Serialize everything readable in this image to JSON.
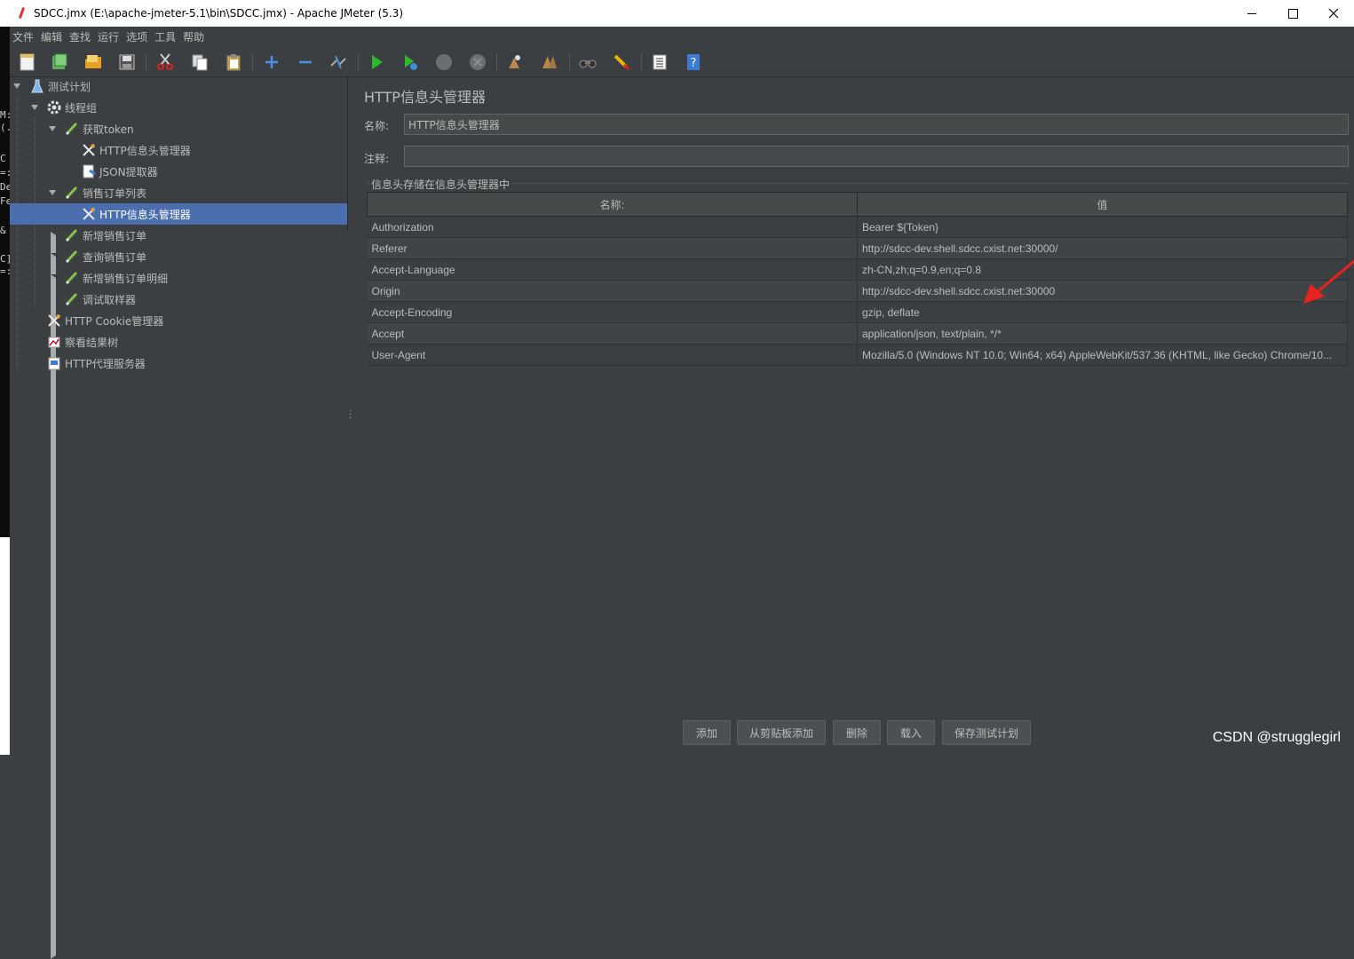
{
  "window": {
    "title": "SDCC.jmx (E:\\apache-jmeter-5.1\\bin\\SDCC.jmx) - Apache JMeter (5.3)"
  },
  "background_terminal": [
    "M:",
    "(.",
    "C",
    "=:",
    "De",
    "Fe",
    "&",
    "C]",
    "=:"
  ],
  "menu": [
    "文件",
    "编辑",
    "查找",
    "运行",
    "选项",
    "工具",
    "帮助"
  ],
  "toolbar": [
    "new-icon",
    "templates-icon",
    "open-icon",
    "save-icon",
    "cut-icon",
    "copy-icon",
    "paste-icon",
    "expand-icon",
    "collapse-icon",
    "toggle-icon",
    "start-icon",
    "start-no-pauses-icon",
    "stop-icon",
    "shutdown-icon",
    "clear-icon",
    "clear-all-icon",
    "search-icon",
    "reset-search-icon",
    "function-helper-icon",
    "help-icon"
  ],
  "tree": {
    "nodes": [
      {
        "label": "测试计划",
        "icon": "test-plan-icon"
      },
      {
        "label": "线程组",
        "icon": "thread-group-icon"
      },
      {
        "label": "获取token",
        "icon": "sampler-icon"
      },
      {
        "label": "HTTP信息头管理器",
        "icon": "config-icon"
      },
      {
        "label": "JSON提取器",
        "icon": "extractor-icon"
      },
      {
        "label": "销售订单列表",
        "icon": "sampler-icon"
      },
      {
        "label": "HTTP信息头管理器",
        "icon": "config-icon"
      },
      {
        "label": "新增销售订单",
        "icon": "sampler-icon"
      },
      {
        "label": "查询销售订单",
        "icon": "sampler-icon"
      },
      {
        "label": "新增销售订单明细",
        "icon": "sampler-icon"
      },
      {
        "label": "调试取样器",
        "icon": "sampler-icon"
      },
      {
        "label": "HTTP Cookie管理器",
        "icon": "config-icon"
      },
      {
        "label": "察看结果树",
        "icon": "listener-icon"
      },
      {
        "label": "HTTP代理服务器",
        "icon": "proxy-icon"
      }
    ]
  },
  "panel": {
    "title": "HTTP信息头管理器",
    "name_label": "名称:",
    "name_value": "HTTP信息头管理器",
    "comment_label": "注释:",
    "comment_value": "",
    "group_title": "信息头存储在信息头管理器中",
    "columns": [
      "名称:",
      "值"
    ],
    "headers": [
      {
        "name": "Authorization",
        "value": "Bearer ${Token}"
      },
      {
        "name": "Referer",
        "value": "http://sdcc-dev.shell.sdcc.cxist.net:30000/"
      },
      {
        "name": "Accept-Language",
        "value": "zh-CN,zh;q=0.9,en;q=0.8"
      },
      {
        "name": "Origin",
        "value": "http://sdcc-dev.shell.sdcc.cxist.net:30000"
      },
      {
        "name": "Accept-Encoding",
        "value": "gzip, deflate"
      },
      {
        "name": "Accept",
        "value": "application/json, text/plain, */*"
      },
      {
        "name": "User-Agent",
        "value": "Mozilla/5.0 (Windows NT 10.0; Win64; x64) AppleWebKit/537.36 (KHTML, like Gecko) Chrome/10..."
      }
    ],
    "buttons": {
      "add": "添加",
      "add_from_clipboard": "从剪贴板添加",
      "delete": "删除",
      "load": "载入",
      "save_test_plan": "保存测试计划"
    }
  },
  "watermark": "CSDN @strugglegirl",
  "colors": {
    "background": "#3c3f41",
    "selection": "#4b6eaf",
    "annotation_arrow": "#e8231d"
  }
}
